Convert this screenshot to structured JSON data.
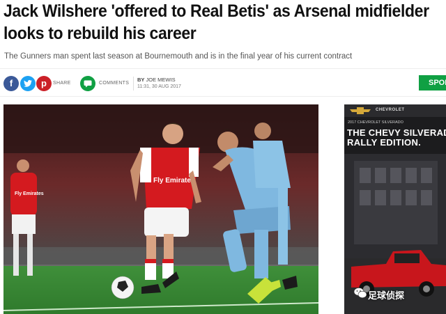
{
  "article": {
    "headline_line1": "Jack Wilshere 'offered to Real Betis' as Arsenal midfielder",
    "headline_line2": "looks to rebuild his career",
    "standfirst": "The Gunners man spent last season at Bournemouth and is in the final year of his current contract"
  },
  "share": {
    "facebook_glyph": "f",
    "twitter_glyph": "t",
    "pinterest_glyph": "p",
    "share_label": "SHARE",
    "comments_label": "COMMENTS"
  },
  "byline": {
    "prefix": "BY",
    "author": "JOE MEWIS",
    "timestamp": "11:31, 30 AUG 2017"
  },
  "nav": {
    "sport_label": "SPOR"
  },
  "photo": {
    "player_front_shirt": "Fly Emirates",
    "player_left_shirt": "Fly Emirates"
  },
  "ad": {
    "brand": "CHEVROLET",
    "small_text": "2017 CHEVROLET SILVERADO",
    "headline_line1": "THE CHEVY SILVERAD",
    "headline_line2": "RALLY EDITION."
  },
  "watermark": {
    "text": "足球侦探"
  },
  "colors": {
    "facebook": "#3b5998",
    "twitter": "#1da1f2",
    "pinterest": "#cb2027",
    "comments": "#10a043",
    "sport_button": "#10a043",
    "arsenal_red": "#d41a1f",
    "city_blue": "#7fb8e0"
  }
}
